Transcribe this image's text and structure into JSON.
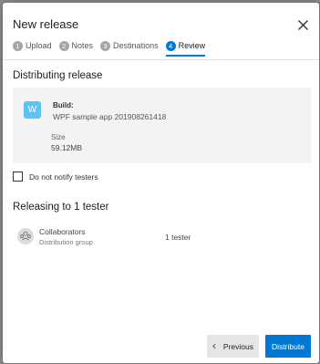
{
  "dialog": {
    "title": "New release",
    "steps": [
      {
        "num": "1",
        "label": "Upload"
      },
      {
        "num": "2",
        "label": "Notes"
      },
      {
        "num": "3",
        "label": "Destinations"
      },
      {
        "num": "4",
        "label": "Review"
      }
    ],
    "active_step": 4
  },
  "distributing": {
    "heading": "Distributing release",
    "app_icon_letter": "W",
    "build_label": "Build:",
    "build_value": "WPF sample app 201908261418",
    "size_label": "Size",
    "size_value": "59.12MB"
  },
  "notify": {
    "label": "Do not notify testers",
    "checked": false
  },
  "releasing": {
    "heading": "Releasing to 1 tester",
    "groups": [
      {
        "name": "Collaborators",
        "type": "Distribution group",
        "count": "1 tester"
      }
    ]
  },
  "buttons": {
    "previous": "Previous",
    "distribute": "Distribute"
  },
  "colors": {
    "accent": "#0078d4",
    "app_icon": "#5bc4f0"
  }
}
